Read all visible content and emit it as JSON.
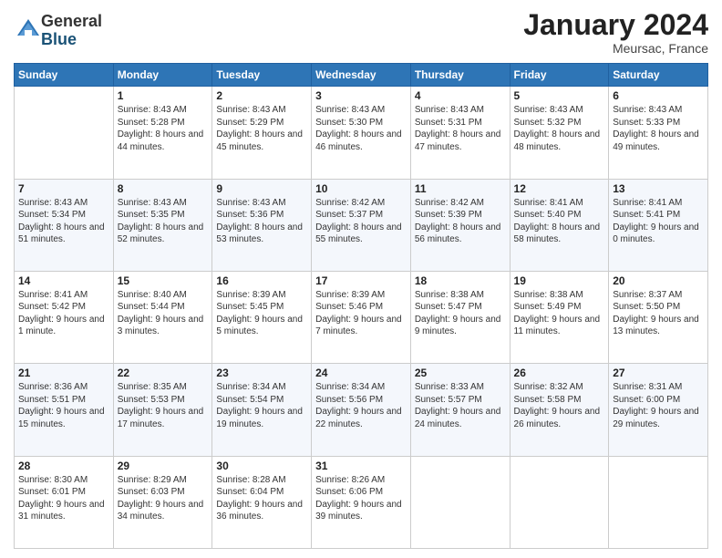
{
  "logo": {
    "general": "General",
    "blue": "Blue"
  },
  "title": "January 2024",
  "location": "Meursac, France",
  "columns": [
    "Sunday",
    "Monday",
    "Tuesday",
    "Wednesday",
    "Thursday",
    "Friday",
    "Saturday"
  ],
  "weeks": [
    [
      {
        "day": "",
        "sunrise": "",
        "sunset": "",
        "daylight": ""
      },
      {
        "day": "1",
        "sunrise": "Sunrise: 8:43 AM",
        "sunset": "Sunset: 5:28 PM",
        "daylight": "Daylight: 8 hours and 44 minutes."
      },
      {
        "day": "2",
        "sunrise": "Sunrise: 8:43 AM",
        "sunset": "Sunset: 5:29 PM",
        "daylight": "Daylight: 8 hours and 45 minutes."
      },
      {
        "day": "3",
        "sunrise": "Sunrise: 8:43 AM",
        "sunset": "Sunset: 5:30 PM",
        "daylight": "Daylight: 8 hours and 46 minutes."
      },
      {
        "day": "4",
        "sunrise": "Sunrise: 8:43 AM",
        "sunset": "Sunset: 5:31 PM",
        "daylight": "Daylight: 8 hours and 47 minutes."
      },
      {
        "day": "5",
        "sunrise": "Sunrise: 8:43 AM",
        "sunset": "Sunset: 5:32 PM",
        "daylight": "Daylight: 8 hours and 48 minutes."
      },
      {
        "day": "6",
        "sunrise": "Sunrise: 8:43 AM",
        "sunset": "Sunset: 5:33 PM",
        "daylight": "Daylight: 8 hours and 49 minutes."
      }
    ],
    [
      {
        "day": "7",
        "sunrise": "Sunrise: 8:43 AM",
        "sunset": "Sunset: 5:34 PM",
        "daylight": "Daylight: 8 hours and 51 minutes."
      },
      {
        "day": "8",
        "sunrise": "Sunrise: 8:43 AM",
        "sunset": "Sunset: 5:35 PM",
        "daylight": "Daylight: 8 hours and 52 minutes."
      },
      {
        "day": "9",
        "sunrise": "Sunrise: 8:43 AM",
        "sunset": "Sunset: 5:36 PM",
        "daylight": "Daylight: 8 hours and 53 minutes."
      },
      {
        "day": "10",
        "sunrise": "Sunrise: 8:42 AM",
        "sunset": "Sunset: 5:37 PM",
        "daylight": "Daylight: 8 hours and 55 minutes."
      },
      {
        "day": "11",
        "sunrise": "Sunrise: 8:42 AM",
        "sunset": "Sunset: 5:39 PM",
        "daylight": "Daylight: 8 hours and 56 minutes."
      },
      {
        "day": "12",
        "sunrise": "Sunrise: 8:41 AM",
        "sunset": "Sunset: 5:40 PM",
        "daylight": "Daylight: 8 hours and 58 minutes."
      },
      {
        "day": "13",
        "sunrise": "Sunrise: 8:41 AM",
        "sunset": "Sunset: 5:41 PM",
        "daylight": "Daylight: 9 hours and 0 minutes."
      }
    ],
    [
      {
        "day": "14",
        "sunrise": "Sunrise: 8:41 AM",
        "sunset": "Sunset: 5:42 PM",
        "daylight": "Daylight: 9 hours and 1 minute."
      },
      {
        "day": "15",
        "sunrise": "Sunrise: 8:40 AM",
        "sunset": "Sunset: 5:44 PM",
        "daylight": "Daylight: 9 hours and 3 minutes."
      },
      {
        "day": "16",
        "sunrise": "Sunrise: 8:39 AM",
        "sunset": "Sunset: 5:45 PM",
        "daylight": "Daylight: 9 hours and 5 minutes."
      },
      {
        "day": "17",
        "sunrise": "Sunrise: 8:39 AM",
        "sunset": "Sunset: 5:46 PM",
        "daylight": "Daylight: 9 hours and 7 minutes."
      },
      {
        "day": "18",
        "sunrise": "Sunrise: 8:38 AM",
        "sunset": "Sunset: 5:47 PM",
        "daylight": "Daylight: 9 hours and 9 minutes."
      },
      {
        "day": "19",
        "sunrise": "Sunrise: 8:38 AM",
        "sunset": "Sunset: 5:49 PM",
        "daylight": "Daylight: 9 hours and 11 minutes."
      },
      {
        "day": "20",
        "sunrise": "Sunrise: 8:37 AM",
        "sunset": "Sunset: 5:50 PM",
        "daylight": "Daylight: 9 hours and 13 minutes."
      }
    ],
    [
      {
        "day": "21",
        "sunrise": "Sunrise: 8:36 AM",
        "sunset": "Sunset: 5:51 PM",
        "daylight": "Daylight: 9 hours and 15 minutes."
      },
      {
        "day": "22",
        "sunrise": "Sunrise: 8:35 AM",
        "sunset": "Sunset: 5:53 PM",
        "daylight": "Daylight: 9 hours and 17 minutes."
      },
      {
        "day": "23",
        "sunrise": "Sunrise: 8:34 AM",
        "sunset": "Sunset: 5:54 PM",
        "daylight": "Daylight: 9 hours and 19 minutes."
      },
      {
        "day": "24",
        "sunrise": "Sunrise: 8:34 AM",
        "sunset": "Sunset: 5:56 PM",
        "daylight": "Daylight: 9 hours and 22 minutes."
      },
      {
        "day": "25",
        "sunrise": "Sunrise: 8:33 AM",
        "sunset": "Sunset: 5:57 PM",
        "daylight": "Daylight: 9 hours and 24 minutes."
      },
      {
        "day": "26",
        "sunrise": "Sunrise: 8:32 AM",
        "sunset": "Sunset: 5:58 PM",
        "daylight": "Daylight: 9 hours and 26 minutes."
      },
      {
        "day": "27",
        "sunrise": "Sunrise: 8:31 AM",
        "sunset": "Sunset: 6:00 PM",
        "daylight": "Daylight: 9 hours and 29 minutes."
      }
    ],
    [
      {
        "day": "28",
        "sunrise": "Sunrise: 8:30 AM",
        "sunset": "Sunset: 6:01 PM",
        "daylight": "Daylight: 9 hours and 31 minutes."
      },
      {
        "day": "29",
        "sunrise": "Sunrise: 8:29 AM",
        "sunset": "Sunset: 6:03 PM",
        "daylight": "Daylight: 9 hours and 34 minutes."
      },
      {
        "day": "30",
        "sunrise": "Sunrise: 8:28 AM",
        "sunset": "Sunset: 6:04 PM",
        "daylight": "Daylight: 9 hours and 36 minutes."
      },
      {
        "day": "31",
        "sunrise": "Sunrise: 8:26 AM",
        "sunset": "Sunset: 6:06 PM",
        "daylight": "Daylight: 9 hours and 39 minutes."
      },
      {
        "day": "",
        "sunrise": "",
        "sunset": "",
        "daylight": ""
      },
      {
        "day": "",
        "sunrise": "",
        "sunset": "",
        "daylight": ""
      },
      {
        "day": "",
        "sunrise": "",
        "sunset": "",
        "daylight": ""
      }
    ]
  ]
}
